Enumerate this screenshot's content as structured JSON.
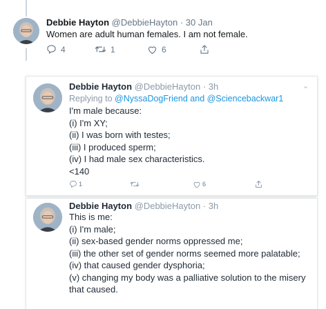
{
  "tweet1": {
    "name": "Debbie Hayton",
    "handle_time": "@DebbieHayton · 30 Jan",
    "text": "Women are adult human females. I am not female.",
    "replies": "4",
    "retweets": "1",
    "likes": "6"
  },
  "tweet2": {
    "name": "Debbie Hayton",
    "handle_time": "@DebbieHayton · 3h",
    "replying_prefix": "Replying to",
    "replying_to": "@NyssaDogFriend and @Sciencebackwar1",
    "lines": [
      "I'm male because:",
      "(i) I'm XY;",
      "(ii) I was born with testes;",
      "(iii) I produced sperm;",
      "(iv) I had male sex characteristics.",
      "<140"
    ],
    "replies": "1",
    "likes": "6"
  },
  "tweet3": {
    "name": "Debbie Hayton",
    "handle_time": "@DebbieHayton · 3h",
    "lines": [
      "This is me:",
      "(i) I'm male;",
      "(ii) sex-based gender norms oppressed me;",
      "(iii) the other set of gender norms seemed more palatable;",
      "(iv) that caused gender dysphoria;",
      "(v) changing my body was a palliative solution to the misery",
      "that caused."
    ]
  },
  "icons": {
    "reply": "reply-icon",
    "retweet": "retweet-icon",
    "like": "heart-icon",
    "share": "share-icon",
    "caret": "chevron-down-icon"
  },
  "colors": {
    "link": "#1b95e0",
    "meta": "#657786",
    "thread_line": "#ccd6dd"
  }
}
